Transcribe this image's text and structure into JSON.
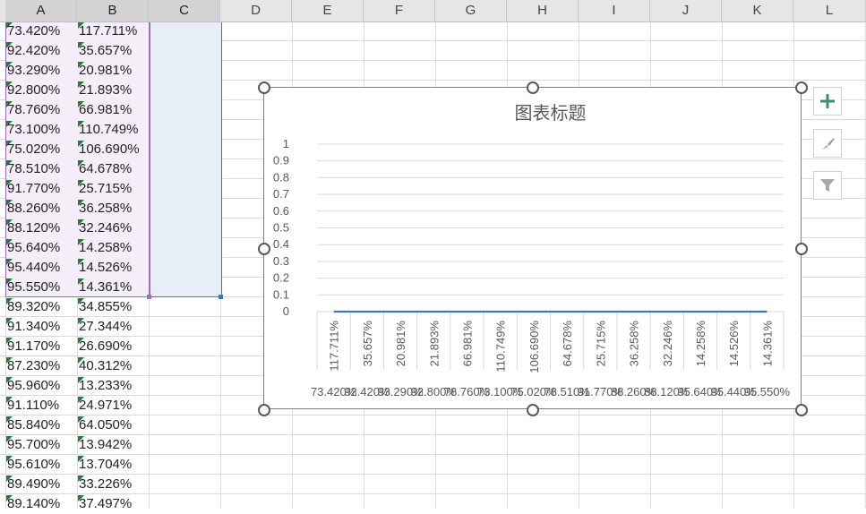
{
  "columns": [
    "A",
    "B",
    "C",
    "D",
    "E",
    "F",
    "G",
    "H",
    "I",
    "J",
    "K",
    "L"
  ],
  "rows": [
    {
      "a": "73.420%",
      "b": "117.711%"
    },
    {
      "a": "92.420%",
      "b": "35.657%"
    },
    {
      "a": "93.290%",
      "b": "20.981%"
    },
    {
      "a": "92.800%",
      "b": "21.893%"
    },
    {
      "a": "78.760%",
      "b": "66.981%"
    },
    {
      "a": "73.100%",
      "b": "110.749%"
    },
    {
      "a": "75.020%",
      "b": "106.690%"
    },
    {
      "a": "78.510%",
      "b": "64.678%"
    },
    {
      "a": "91.770%",
      "b": "25.715%"
    },
    {
      "a": "88.260%",
      "b": "36.258%"
    },
    {
      "a": "88.120%",
      "b": "32.246%"
    },
    {
      "a": "95.640%",
      "b": "14.258%"
    },
    {
      "a": "95.440%",
      "b": "14.526%"
    },
    {
      "a": "95.550%",
      "b": "14.361%"
    },
    {
      "a": "89.320%",
      "b": "34.855%"
    },
    {
      "a": "91.340%",
      "b": "27.344%"
    },
    {
      "a": "91.170%",
      "b": "26.690%"
    },
    {
      "a": "87.230%",
      "b": "40.312%"
    },
    {
      "a": "95.960%",
      "b": "13.233%"
    },
    {
      "a": "91.110%",
      "b": "24.971%"
    },
    {
      "a": "85.840%",
      "b": "64.050%"
    },
    {
      "a": "95.700%",
      "b": "13.942%"
    },
    {
      "a": "95.610%",
      "b": "13.704%"
    },
    {
      "a": "89.490%",
      "b": "33.226%"
    },
    {
      "a": "89.140%",
      "b": "37.497%"
    }
  ],
  "chart_data": {
    "type": "line",
    "title": "图表标题",
    "y_ticks": [
      "1",
      "0.9",
      "0.8",
      "0.7",
      "0.6",
      "0.5",
      "0.4",
      "0.3",
      "0.2",
      "0.1",
      "0"
    ],
    "ylim": [
      0,
      1
    ],
    "outer_labels": [
      "73.420%",
      "92.420%",
      "93.290%",
      "92.800%",
      "78.760%",
      "73.100%",
      "75.020%",
      "78.510%",
      "91.770%",
      "88.260%",
      "88.120%",
      "95.640%",
      "95.440%",
      "95.550%"
    ],
    "inner_labels": [
      "117.711%",
      "35.657%",
      "20.981%",
      "21.893%",
      "66.981%",
      "110.749%",
      "106.690%",
      "64.678%",
      "25.715%",
      "36.258%",
      "32.246%",
      "14.258%",
      "14.526%",
      "14.361%"
    ],
    "values": [
      0,
      0,
      0,
      0,
      0,
      0,
      0,
      0,
      0,
      0,
      0,
      0,
      0,
      0
    ],
    "series_color": "#4472c4",
    "grid": true
  },
  "chart_buttons": {
    "add": "chart-elements",
    "style": "chart-styles",
    "filter": "chart-filters"
  }
}
